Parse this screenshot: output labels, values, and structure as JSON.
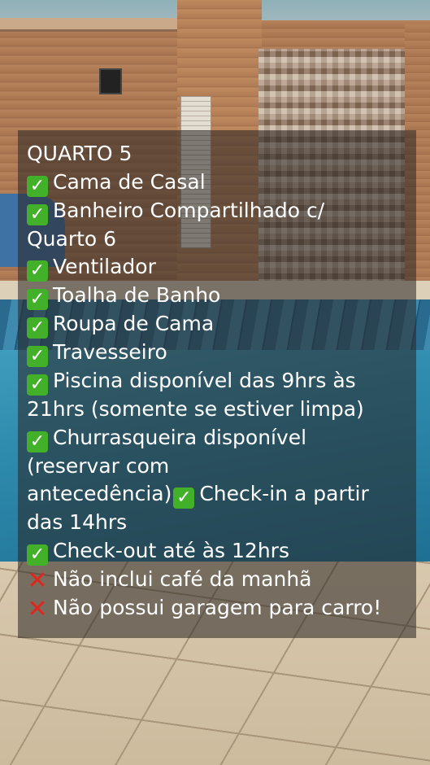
{
  "items": {
    "title": "QUARTO 5",
    "l1": "Cama de Casal",
    "l2a": "Banheiro Compartilhado c/",
    "l2b": "Quarto 6",
    "l3": "Ventilador",
    "l4": "Toalha de Banho",
    "l5": "Roupa de Cama",
    "l6": "Travesseiro",
    "l7a": "Piscina disponível das 9hrs às",
    "l7b": "21hrs (somente se estiver limpa)",
    "l8a": "Churrasqueira disponível",
    "l8b": "(reservar com",
    "l8c": "antecedência)",
    "l8d": "Check-in a partir",
    "l8e": "das 14hrs",
    "l9": "Check-out até às 12hrs",
    "l10": "Não inclui café da manhã",
    "l11": "Não possui garagem para carro!"
  },
  "icons": {
    "check": "check-mark-icon",
    "cross": "cross-mark-icon"
  },
  "colors": {
    "check_bg": "#43b02a",
    "cross": "#e0261c",
    "text": "#ffffff"
  }
}
